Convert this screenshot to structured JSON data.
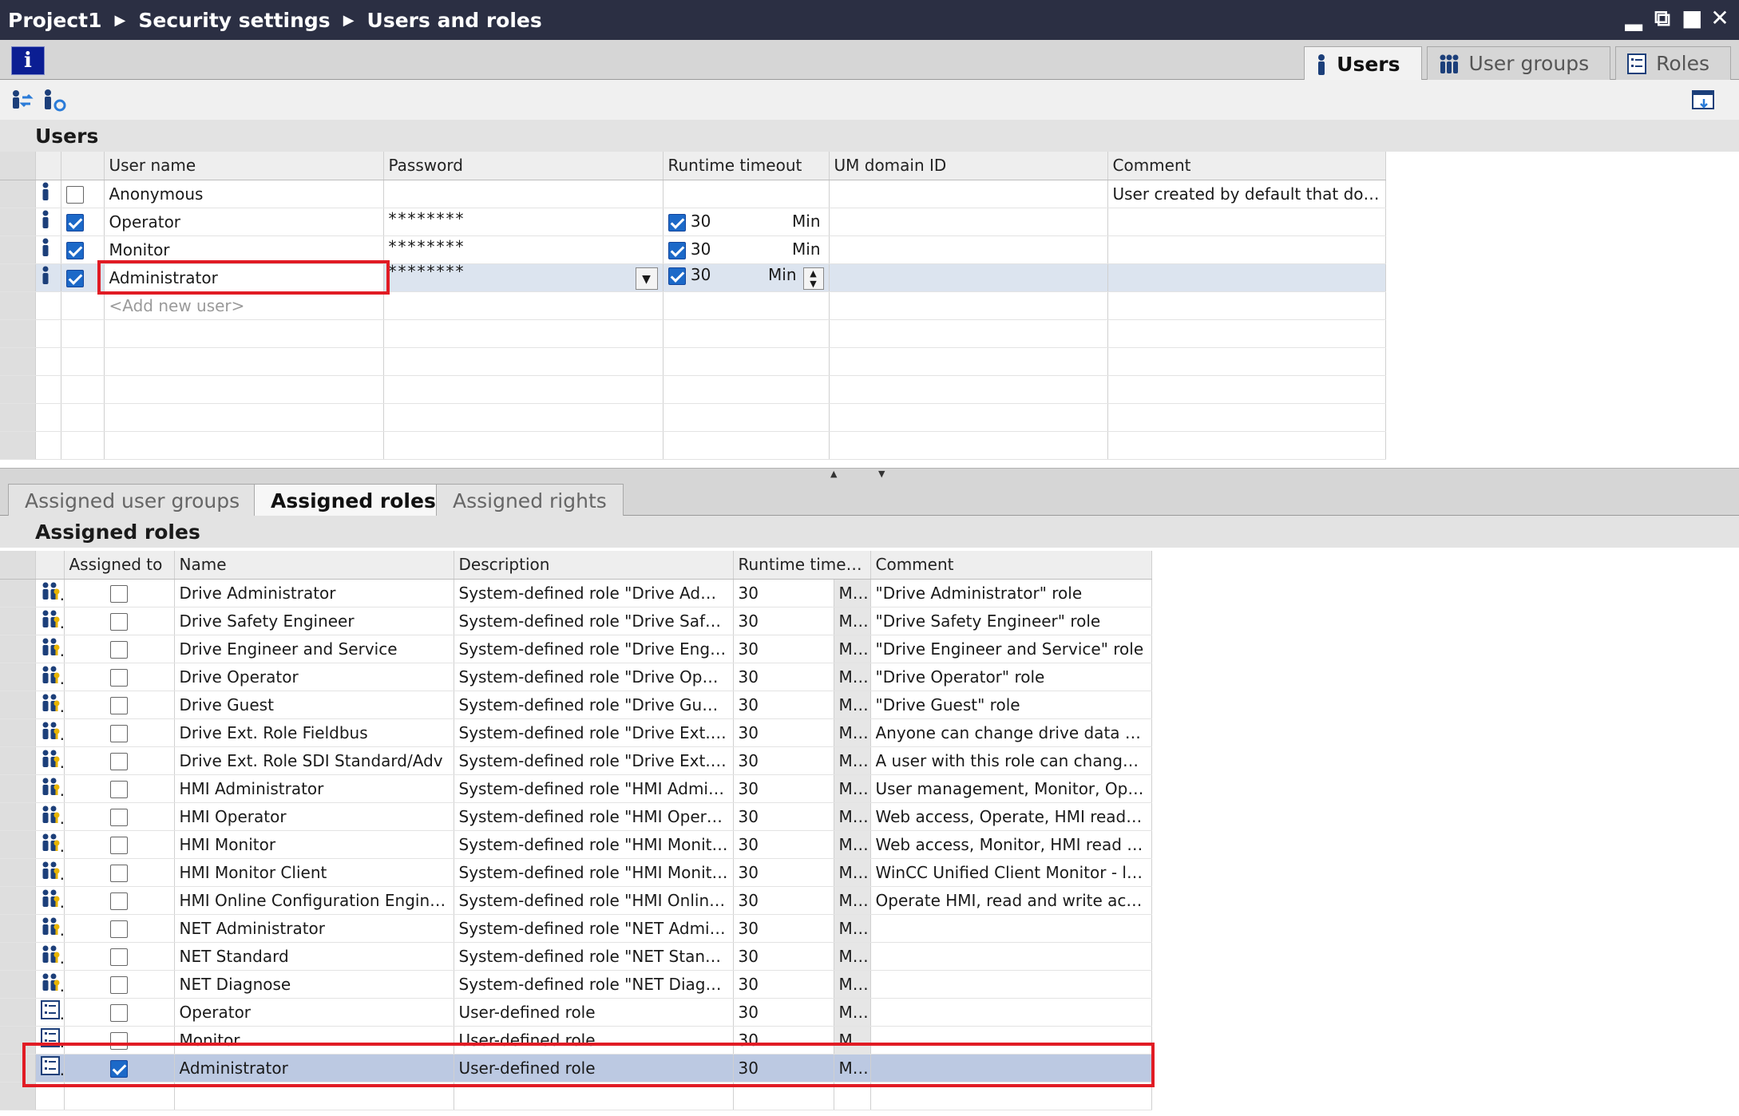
{
  "breadcrumb": [
    "Project1",
    "Security settings",
    "Users and roles"
  ],
  "window_controls": [
    "minimize-icon",
    "restore-icon",
    "maximize-icon",
    "close-icon"
  ],
  "info_button": "i",
  "top_tabs": [
    {
      "label": "Users",
      "active": true,
      "icon": "user-icon"
    },
    {
      "label": "User groups",
      "active": false,
      "icon": "user-group-icon"
    },
    {
      "label": "Roles",
      "active": false,
      "icon": "role-list-icon"
    }
  ],
  "users_section": {
    "title": "Users",
    "columns": [
      "User name",
      "Password",
      "Runtime timeout",
      "UM domain ID",
      "Comment"
    ],
    "rows": [
      {
        "name": "Anonymous",
        "enabled": false,
        "password": "",
        "timeout_enabled": null,
        "timeout": "",
        "unit": "",
        "domain": "",
        "comment": "User created by default that does ..."
      },
      {
        "name": "Operator",
        "enabled": true,
        "password": "********",
        "timeout_enabled": true,
        "timeout": "30",
        "unit": "Min",
        "domain": "",
        "comment": ""
      },
      {
        "name": "Monitor",
        "enabled": true,
        "password": "********",
        "timeout_enabled": true,
        "timeout": "30",
        "unit": "Min",
        "domain": "",
        "comment": ""
      },
      {
        "name": "Administrator",
        "enabled": true,
        "password": "********",
        "timeout_enabled": true,
        "timeout": "30",
        "unit": "Min",
        "domain": "",
        "comment": "",
        "selected": true
      }
    ],
    "add_new": "<Add new user>"
  },
  "bottom_tabs": [
    {
      "label": "Assigned user groups",
      "active": false
    },
    {
      "label": "Assigned roles",
      "active": true
    },
    {
      "label": "Assigned rights",
      "active": false
    }
  ],
  "roles_section": {
    "title": "Assigned roles",
    "columns": [
      "Assigned to",
      "Name",
      "Description",
      "Runtime timeout",
      "Comment"
    ],
    "rows": [
      {
        "icon": "system-role-icon",
        "assigned": false,
        "name": "Drive Administrator",
        "description": "System-defined role \"Drive Admini...",
        "timeout": "30",
        "unit": "Min",
        "comment": "\"Drive Administrator\" role"
      },
      {
        "icon": "system-role-icon",
        "assigned": false,
        "name": "Drive Safety Engineer",
        "description": "System-defined role \"Drive Safety ...",
        "timeout": "30",
        "unit": "Min",
        "comment": "\"Drive Safety Engineer\" role"
      },
      {
        "icon": "system-role-icon",
        "assigned": false,
        "name": "Drive Engineer and Service",
        "description": "System-defined role \"Drive Engine...",
        "timeout": "30",
        "unit": "Min",
        "comment": "\"Drive Engineer and Service\" role"
      },
      {
        "icon": "system-role-icon",
        "assigned": false,
        "name": "Drive Operator",
        "description": "System-defined role \"Drive Operat...",
        "timeout": "30",
        "unit": "Min",
        "comment": "\"Drive Operator\" role"
      },
      {
        "icon": "system-role-icon",
        "assigned": false,
        "name": "Drive Guest",
        "description": "System-defined role \"Drive Guest\"",
        "timeout": "30",
        "unit": "Min",
        "comment": "\"Drive Guest\" role"
      },
      {
        "icon": "system-role-icon",
        "assigned": false,
        "name": "Drive Ext. Role Fieldbus",
        "description": "System-defined role \"Drive Ext. Rol...",
        "timeout": "30",
        "unit": "Min",
        "comment": "Anyone can change drive data via..."
      },
      {
        "icon": "system-role-icon",
        "assigned": false,
        "name": "Drive Ext. Role SDI Standard/Adv",
        "description": "System-defined role \"Drive Ext. Rol...",
        "timeout": "30",
        "unit": "Min",
        "comment": "A user with this role can change d..."
      },
      {
        "icon": "system-role-icon",
        "assigned": false,
        "name": "HMI Administrator",
        "description": "System-defined role \"HMI Adminis...",
        "timeout": "30",
        "unit": "Min",
        "comment": "User management, Monitor, Oper..."
      },
      {
        "icon": "system-role-icon",
        "assigned": false,
        "name": "HMI Operator",
        "description": "System-defined role \"HMI Operator\"",
        "timeout": "30",
        "unit": "Min",
        "comment": "Web access, Operate, HMI read an..."
      },
      {
        "icon": "system-role-icon",
        "assigned": false,
        "name": "HMI Monitor",
        "description": "System-defined role \"HMI Monitor\"",
        "timeout": "30",
        "unit": "Min",
        "comment": "Web access, Monitor, HMI read ac..."
      },
      {
        "icon": "system-role-icon",
        "assigned": false,
        "name": "HMI Monitor Client",
        "description": "System-defined role \"HMI Monitor ...",
        "timeout": "30",
        "unit": "Min",
        "comment": "WinCC Unified Client Monitor - limi..."
      },
      {
        "icon": "system-role-icon",
        "assigned": false,
        "name": "HMI Online Configuration Engineer",
        "description": "System-defined role \"HMI Online C...",
        "timeout": "30",
        "unit": "Min",
        "comment": "Operate HMI, read and write acce..."
      },
      {
        "icon": "system-role-icon",
        "assigned": false,
        "name": "NET Administrator",
        "description": "System-defined role \"NET Adminis...",
        "timeout": "30",
        "unit": "Min",
        "comment": ""
      },
      {
        "icon": "system-role-icon",
        "assigned": false,
        "name": "NET Standard",
        "description": "System-defined role \"NET Standard\"",
        "timeout": "30",
        "unit": "Min",
        "comment": ""
      },
      {
        "icon": "system-role-icon",
        "assigned": false,
        "name": "NET Diagnose",
        "description": "System-defined role \"NET Diagnos...",
        "timeout": "30",
        "unit": "Min",
        "comment": ""
      },
      {
        "icon": "user-role-icon",
        "assigned": false,
        "name": "Operator",
        "description": "User-defined role",
        "timeout": "30",
        "unit": "Min",
        "comment": ""
      },
      {
        "icon": "user-role-icon",
        "assigned": false,
        "name": "Monitor",
        "description": "User-defined role",
        "timeout": "30",
        "unit": "Min",
        "comment": ""
      },
      {
        "icon": "user-role-icon",
        "assigned": true,
        "name": "Administrator",
        "description": "User-defined role",
        "timeout": "30",
        "unit": "Min",
        "comment": "",
        "selected": true
      }
    ]
  },
  "colors": {
    "titlebar": "#2b2f43",
    "checkbox": "#1c69c8",
    "highlight": "#e11b24",
    "selected_row": "#bcc9e2"
  }
}
